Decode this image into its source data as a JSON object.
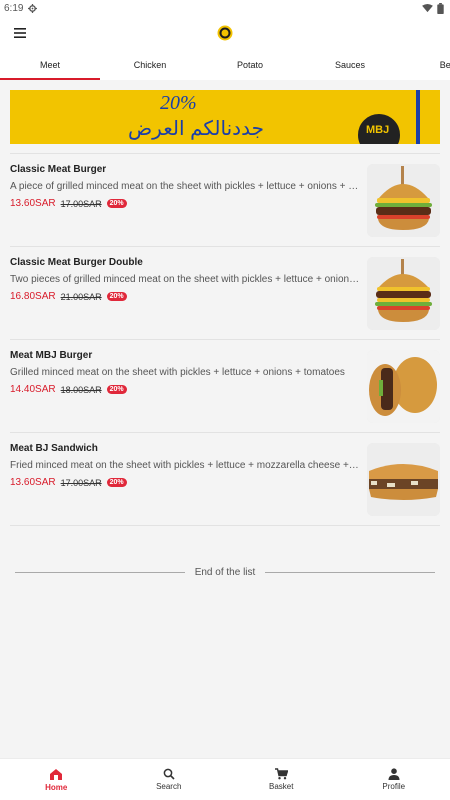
{
  "status_bar": {
    "time": "6:19",
    "icons": [
      "settings-gear-icon",
      "wifi-icon",
      "battery-icon"
    ]
  },
  "app_bar": {
    "menu_icon": "hamburger-menu-icon",
    "logo_icon": "mbj-logo-icon"
  },
  "tabs": [
    {
      "label": "Meet",
      "active": true
    },
    {
      "label": "Chicken",
      "active": false
    },
    {
      "label": "Potato",
      "active": false
    },
    {
      "label": "Sauces",
      "active": false
    },
    {
      "label": "Beve",
      "active": false
    }
  ],
  "banner": {
    "percent": "20%",
    "text": "جددنالكم العرض"
  },
  "items": [
    {
      "name": "Classic Meat Burger",
      "description": "A piece of grilled minced meat on the sheet with pickles + lettuce + onions + tomatoes",
      "price": "13.60SAR",
      "old_price": "17.00SAR",
      "discount": "20%",
      "image": "burger-image"
    },
    {
      "name": "Classic Meat Burger Double",
      "description": "Two pieces of grilled minced meat on the sheet with pickles + lettuce + onions + tomatoes",
      "price": "16.80SAR",
      "old_price": "21.00SAR",
      "discount": "20%",
      "image": "double-burger-image"
    },
    {
      "name": "Meat MBJ Burger",
      "description": "Grilled minced meat on the sheet with pickles + lettuce + onions + tomatoes",
      "price": "14.40SAR",
      "old_price": "18.00SAR",
      "discount": "20%",
      "image": "mbj-burger-image"
    },
    {
      "name": "Meat BJ Sandwich",
      "description": "Fried minced meat on the sheet with pickles + lettuce + mozzarella cheese + sauce",
      "price": "13.60SAR",
      "old_price": "17.00SAR",
      "discount": "20%",
      "image": "sandwich-image"
    }
  ],
  "end_of_list": "End of the list",
  "bottom_nav": [
    {
      "label": "Home",
      "icon": "home-icon",
      "active": true
    },
    {
      "label": "Search",
      "icon": "search-icon",
      "active": false
    },
    {
      "label": "Basket",
      "icon": "cart-icon",
      "active": false
    },
    {
      "label": "Profile",
      "icon": "person-icon",
      "active": false
    }
  ],
  "colors": {
    "accent": "#d81b2a",
    "banner_yellow": "#f2c400",
    "banner_blue": "#1a3ea8"
  }
}
